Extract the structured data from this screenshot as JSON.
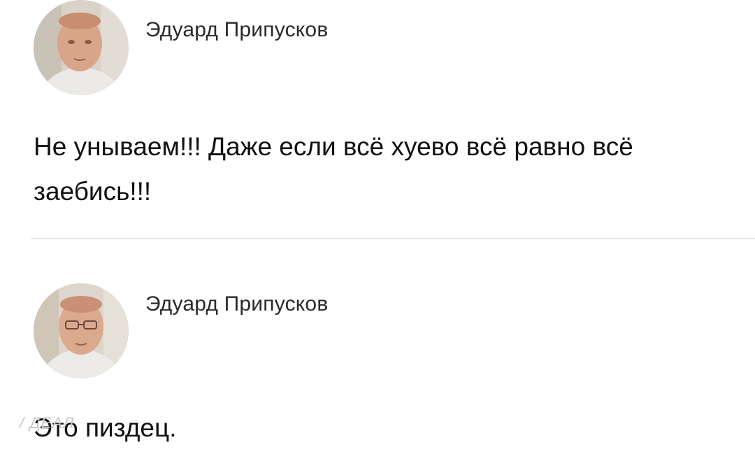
{
  "posts": [
    {
      "author": "Эдуард Припусков",
      "text": "Не унываем!!! Даже если всё хуево всё равно всё заебись!!!"
    },
    {
      "author": "Эдуард Припусков",
      "text": "Это пиздец."
    }
  ],
  "watermark": "/ ДЕАЛ",
  "icons": {
    "avatar": "user-photo"
  }
}
